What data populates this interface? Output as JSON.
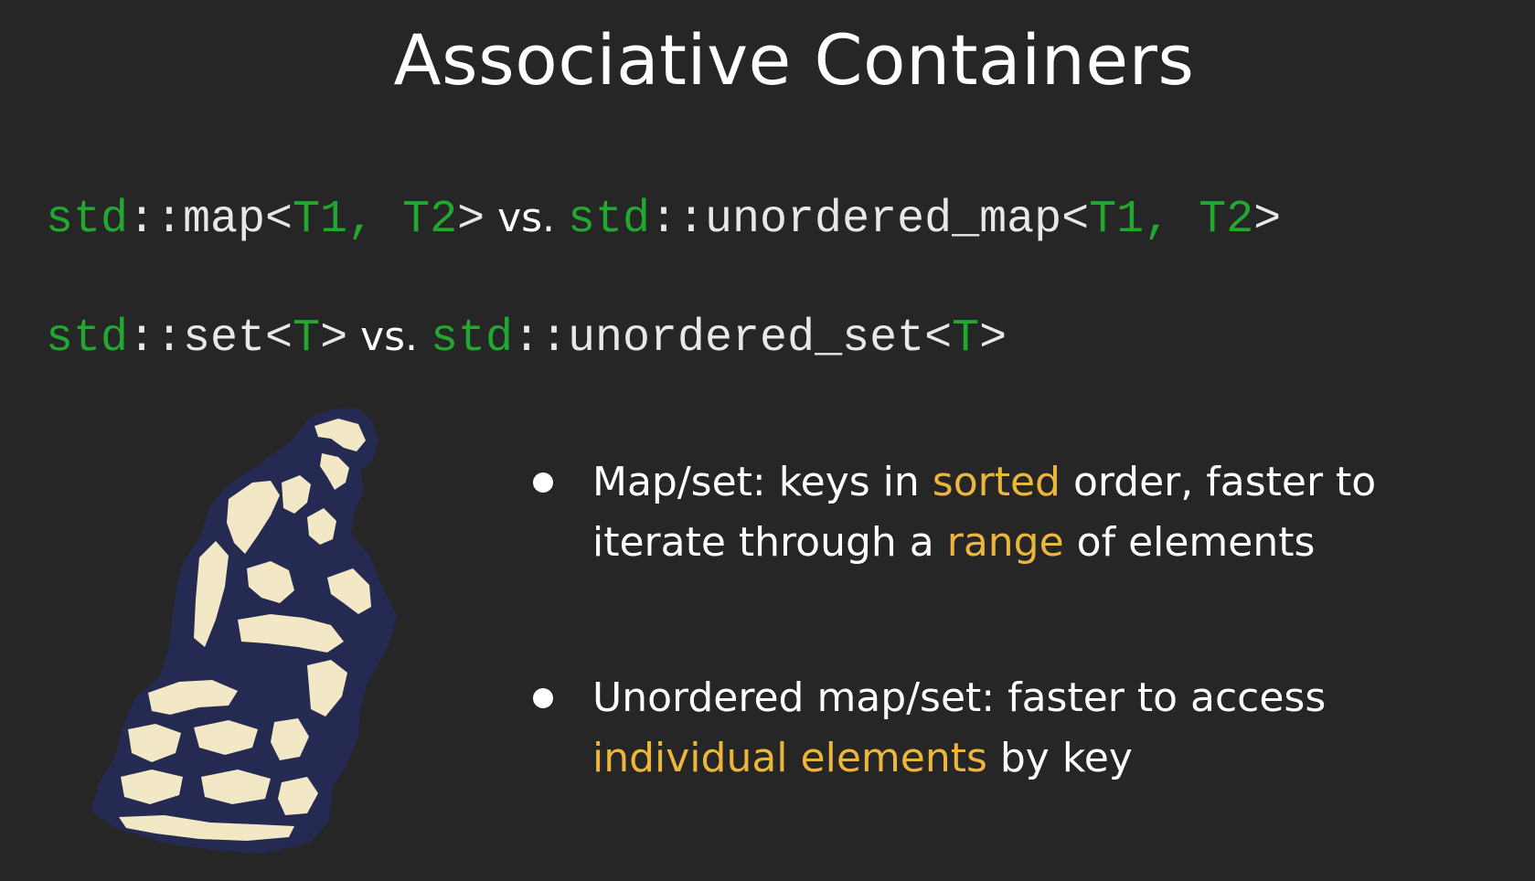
{
  "slide": {
    "title": "Associative Containers"
  },
  "code": {
    "line1": [
      {
        "text": "std",
        "color": "green"
      },
      {
        "text": "::map<",
        "color": "white"
      },
      {
        "text": "T1, T2",
        "color": "green"
      },
      {
        "text": ">",
        "color": "white"
      },
      {
        "text": " vs. ",
        "color": "vs"
      },
      {
        "text": "std",
        "color": "green"
      },
      {
        "text": "::unordered_map<",
        "color": "white"
      },
      {
        "text": "T1, T2",
        "color": "green"
      },
      {
        "text": ">",
        "color": "white"
      }
    ],
    "line2": [
      {
        "text": "std",
        "color": "green"
      },
      {
        "text": "::set<",
        "color": "white"
      },
      {
        "text": "T",
        "color": "green"
      },
      {
        "text": ">",
        "color": "white"
      },
      {
        "text": " vs. ",
        "color": "vs"
      },
      {
        "text": "std",
        "color": "green"
      },
      {
        "text": "::unordered_set<",
        "color": "white"
      },
      {
        "text": "T",
        "color": "green"
      },
      {
        "text": ">",
        "color": "white"
      }
    ]
  },
  "bullets": [
    {
      "parts": [
        {
          "text": "Map/set: keys in ",
          "highlight": false
        },
        {
          "text": "sorted",
          "highlight": true
        },
        {
          "text": " order, faster to iterate through a ",
          "highlight": false
        },
        {
          "text": "range",
          "highlight": true
        },
        {
          "text": " of elements",
          "highlight": false
        }
      ]
    },
    {
      "parts": [
        {
          "text": "Unordered map/set: faster to access ",
          "highlight": false
        },
        {
          "text": "individual elements",
          "highlight": true
        },
        {
          "text": " by key",
          "highlight": false
        }
      ]
    }
  ],
  "image": {
    "icon": "thinker-statue-icon"
  },
  "colors": {
    "background": "#262626",
    "code_green": "#22a830",
    "highlight": "#ecb63c",
    "statue_fill": "#242a52",
    "statue_highlight": "#f3e8c6"
  }
}
